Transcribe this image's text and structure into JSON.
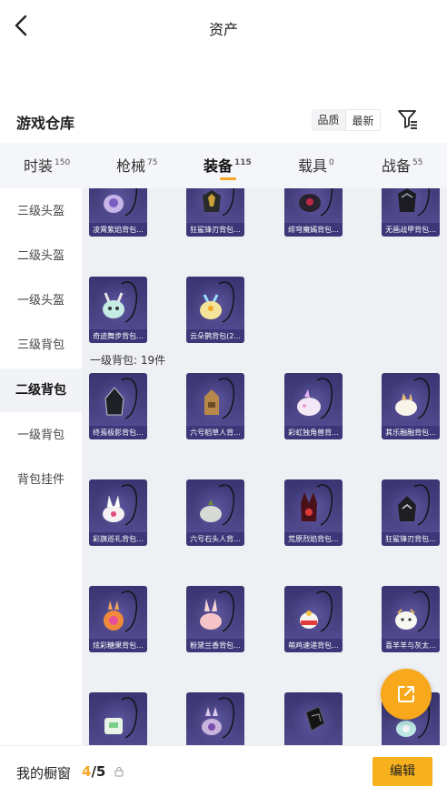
{
  "header": {
    "title": "资产"
  },
  "warehouse": {
    "title": "游戏仓库",
    "sort_options": [
      "品质",
      "最新"
    ],
    "active_sort": "最新"
  },
  "tabs": [
    {
      "label": "时装",
      "count": "150"
    },
    {
      "label": "枪械",
      "count": "75"
    },
    {
      "label": "装备",
      "count": "115",
      "active": true
    },
    {
      "label": "载具",
      "count": "0"
    },
    {
      "label": "战备",
      "count": "55"
    }
  ],
  "sidebar": {
    "items": [
      "三级头盔",
      "二级头盔",
      "一级头盔",
      "三级背包",
      "二级背包",
      "一级背包",
      "背包挂件"
    ],
    "active": "二级背包"
  },
  "content": {
    "top_row": [
      "凌霄紫焰背包...",
      "狂鲨锋刃背包...",
      "绯穹魔嫣背包...",
      "无画战甲背包..."
    ],
    "second_row": [
      "奇迹舞步背包...",
      "云朵鹊背包(2..."
    ],
    "group_title": "一级背包: 19件",
    "group_items": [
      "终焉极影背包...",
      "六号稻草人背...",
      "彩虹独角兽背...",
      "其乐融融背包...",
      "彩旗巡礼背包...",
      "六号石头人背...",
      "荒原烈焰背包...",
      "狂鲨锋刃背包...",
      "炫彩糖果背包...",
      "粉黛兰香背包...",
      "萌鸡速递背包...",
      "喜羊羊与灰太..."
    ]
  },
  "bottom": {
    "label": "我的橱窗",
    "current": "4",
    "total": "/5",
    "edit_label": "编辑"
  },
  "colors": {
    "accent": "#f7b11d",
    "card_bg": "#46407f"
  }
}
